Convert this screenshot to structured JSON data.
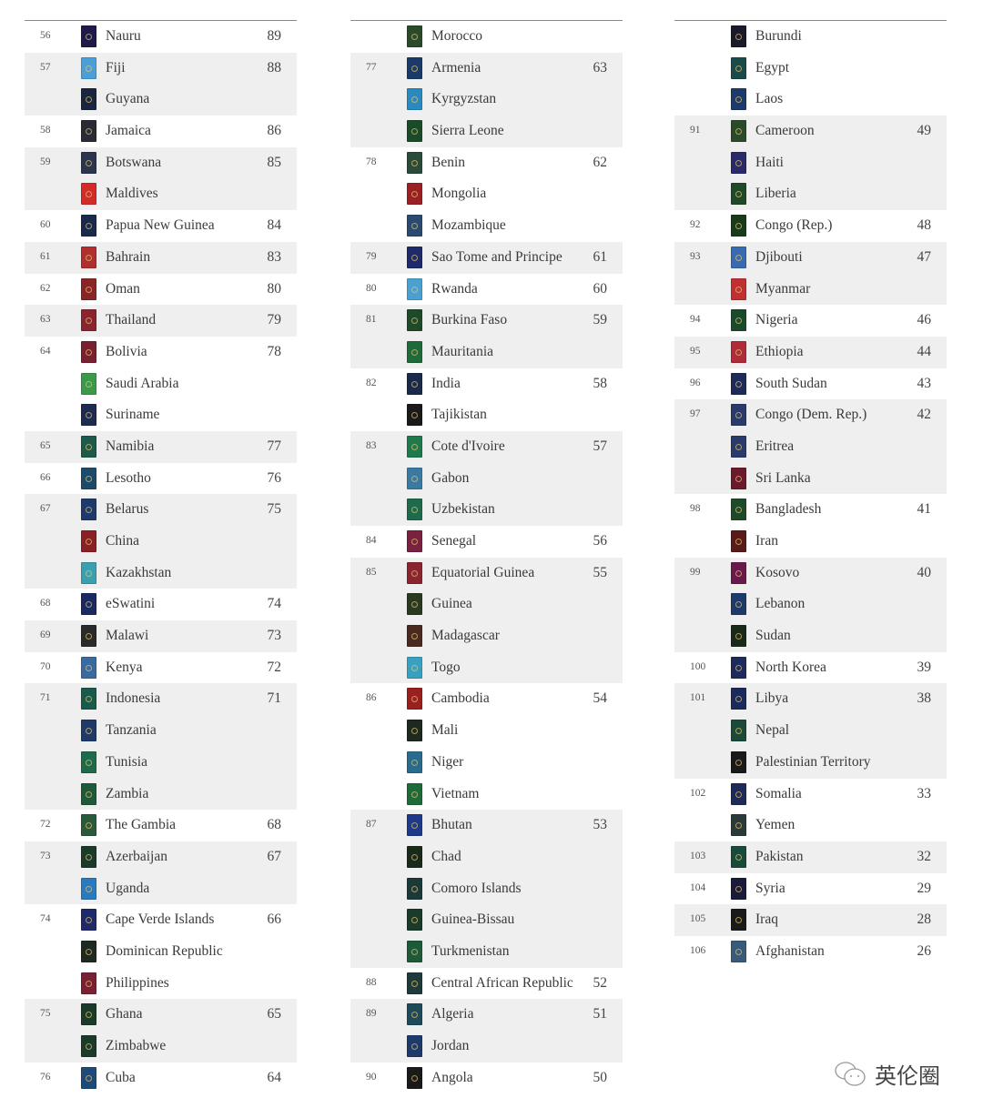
{
  "columns": [
    [
      {
        "rank": "56",
        "score": "89",
        "countries": [
          {
            "name": "Nauru",
            "color": "#1e1a4a"
          }
        ]
      },
      {
        "rank": "57",
        "score": "88",
        "countries": [
          {
            "name": "Fiji",
            "color": "#4a9fd8"
          },
          {
            "name": "Guyana",
            "color": "#1a2540"
          }
        ]
      },
      {
        "rank": "58",
        "score": "86",
        "countries": [
          {
            "name": "Jamaica",
            "color": "#2a2a35"
          }
        ]
      },
      {
        "rank": "59",
        "score": "85",
        "countries": [
          {
            "name": "Botswana",
            "color": "#2b3550"
          },
          {
            "name": "Maldives",
            "color": "#d42a2a"
          }
        ]
      },
      {
        "rank": "60",
        "score": "84",
        "countries": [
          {
            "name": "Papua New Guinea",
            "color": "#1a2a4a"
          }
        ]
      },
      {
        "rank": "61",
        "score": "83",
        "countries": [
          {
            "name": "Bahrain",
            "color": "#b03030"
          }
        ]
      },
      {
        "rank": "62",
        "score": "80",
        "countries": [
          {
            "name": "Oman",
            "color": "#8a2525"
          }
        ]
      },
      {
        "rank": "63",
        "score": "79",
        "countries": [
          {
            "name": "Thailand",
            "color": "#8a2530"
          }
        ]
      },
      {
        "rank": "64",
        "score": "78",
        "countries": [
          {
            "name": "Bolivia",
            "color": "#7a2030"
          },
          {
            "name": "Saudi Arabia",
            "color": "#3a9a4a"
          },
          {
            "name": "Suriname",
            "color": "#1f2a50"
          }
        ]
      },
      {
        "rank": "65",
        "score": "77",
        "countries": [
          {
            "name": "Namibia",
            "color": "#1d5a4a"
          }
        ]
      },
      {
        "rank": "66",
        "score": "76",
        "countries": [
          {
            "name": "Lesotho",
            "color": "#1e4a6a"
          }
        ]
      },
      {
        "rank": "67",
        "score": "75",
        "countries": [
          {
            "name": "Belarus",
            "color": "#1e3a6a"
          },
          {
            "name": "China",
            "color": "#8a2025"
          },
          {
            "name": "Kazakhstan",
            "color": "#3aa0b0"
          }
        ]
      },
      {
        "rank": "68",
        "score": "74",
        "countries": [
          {
            "name": "eSwatini",
            "color": "#1a2a60"
          }
        ]
      },
      {
        "rank": "69",
        "score": "73",
        "countries": [
          {
            "name": "Malawi",
            "color": "#2a2a2a"
          }
        ]
      },
      {
        "rank": "70",
        "score": "72",
        "countries": [
          {
            "name": "Kenya",
            "color": "#3a6aa0"
          }
        ]
      },
      {
        "rank": "71",
        "score": "71",
        "countries": [
          {
            "name": "Indonesia",
            "color": "#1a5a4a"
          },
          {
            "name": "Tanzania",
            "color": "#1e3a6a"
          },
          {
            "name": "Tunisia",
            "color": "#1e6a4a"
          },
          {
            "name": "Zambia",
            "color": "#1e5a3a"
          }
        ]
      },
      {
        "rank": "72",
        "score": "68",
        "countries": [
          {
            "name": "The Gambia",
            "color": "#2a5a3a"
          }
        ]
      },
      {
        "rank": "73",
        "score": "67",
        "countries": [
          {
            "name": "Azerbaijan",
            "color": "#1a3a2a"
          },
          {
            "name": "Uganda",
            "color": "#2a7ac0"
          }
        ]
      },
      {
        "rank": "74",
        "score": "66",
        "countries": [
          {
            "name": "Cape Verde Islands",
            "color": "#1e2a6a"
          },
          {
            "name": "Dominican Republic",
            "color": "#1e2a20"
          },
          {
            "name": "Philippines",
            "color": "#7a2035"
          }
        ]
      },
      {
        "rank": "75",
        "score": "65",
        "countries": [
          {
            "name": "Ghana",
            "color": "#1a3a2a"
          },
          {
            "name": "Zimbabwe",
            "color": "#1a3a2a"
          }
        ]
      },
      {
        "rank": "76",
        "score": "64",
        "countries": [
          {
            "name": "Cuba",
            "color": "#1e4a7a"
          }
        ]
      }
    ],
    [
      {
        "rank": "",
        "score": "",
        "countries": [
          {
            "name": "Morocco",
            "color": "#2a4a2a"
          }
        ]
      },
      {
        "rank": "77",
        "score": "63",
        "countries": [
          {
            "name": "Armenia",
            "color": "#1a3a6a"
          },
          {
            "name": "Kyrgyzstan",
            "color": "#2a8ac0"
          },
          {
            "name": "Sierra Leone",
            "color": "#1a4a2a"
          }
        ]
      },
      {
        "rank": "78",
        "score": "62",
        "countries": [
          {
            "name": "Benin",
            "color": "#2a4a3a"
          },
          {
            "name": "Mongolia",
            "color": "#9a2025"
          },
          {
            "name": "Mozambique",
            "color": "#2a4a70"
          }
        ]
      },
      {
        "rank": "79",
        "score": "61",
        "countries": [
          {
            "name": "Sao Tome and Principe",
            "color": "#1e2a6a"
          }
        ]
      },
      {
        "rank": "80",
        "score": "60",
        "countries": [
          {
            "name": "Rwanda",
            "color": "#4aa0d0"
          }
        ]
      },
      {
        "rank": "81",
        "score": "59",
        "countries": [
          {
            "name": "Burkina Faso",
            "color": "#1e4a2a"
          },
          {
            "name": "Mauritania",
            "color": "#1e6a3a"
          }
        ]
      },
      {
        "rank": "82",
        "score": "58",
        "countries": [
          {
            "name": "India",
            "color": "#1a2a4a"
          },
          {
            "name": "Tajikistan",
            "color": "#1a1a1a"
          }
        ]
      },
      {
        "rank": "83",
        "score": "57",
        "countries": [
          {
            "name": "Cote d'Ivoire",
            "color": "#1e7a4a"
          },
          {
            "name": "Gabon",
            "color": "#3a7aa0"
          },
          {
            "name": "Uzbekistan",
            "color": "#1e6a4a"
          }
        ]
      },
      {
        "rank": "84",
        "score": "56",
        "countries": [
          {
            "name": "Senegal",
            "color": "#7a2040"
          }
        ]
      },
      {
        "rank": "85",
        "score": "55",
        "countries": [
          {
            "name": "Equatorial Guinea",
            "color": "#8a2530"
          },
          {
            "name": "Guinea",
            "color": "#2a3a20"
          },
          {
            "name": "Madagascar",
            "color": "#4a2a20"
          },
          {
            "name": "Togo",
            "color": "#3aa0c0"
          }
        ]
      },
      {
        "rank": "86",
        "score": "54",
        "countries": [
          {
            "name": "Cambodia",
            "color": "#9a2020"
          },
          {
            "name": "Mali",
            "color": "#1e2a20"
          },
          {
            "name": "Niger",
            "color": "#2a6a8a"
          },
          {
            "name": "Vietnam",
            "color": "#1e6a3a"
          }
        ]
      },
      {
        "rank": "87",
        "score": "53",
        "countries": [
          {
            "name": "Bhutan",
            "color": "#1e3a8a"
          },
          {
            "name": "Chad",
            "color": "#1a2a1a"
          },
          {
            "name": "Comoro Islands",
            "color": "#1a3a3a"
          },
          {
            "name": "Guinea-Bissau",
            "color": "#1a3a2a"
          },
          {
            "name": "Turkmenistan",
            "color": "#1e5a3a"
          }
        ]
      },
      {
        "rank": "88",
        "score": "52",
        "countries": [
          {
            "name": "Central African Republic",
            "color": "#1e3a3a"
          }
        ]
      },
      {
        "rank": "89",
        "score": "51",
        "countries": [
          {
            "name": "Algeria",
            "color": "#1e4a5a"
          },
          {
            "name": "Jordan",
            "color": "#1e3a6a"
          }
        ]
      },
      {
        "rank": "90",
        "score": "50",
        "countries": [
          {
            "name": "Angola",
            "color": "#1a1a1a"
          }
        ]
      }
    ],
    [
      {
        "rank": "",
        "score": "",
        "countries": [
          {
            "name": "Burundi",
            "color": "#1a1a2a"
          },
          {
            "name": "Egypt",
            "color": "#1a4a4a"
          },
          {
            "name": "Laos",
            "color": "#1e3a6a"
          }
        ]
      },
      {
        "rank": "91",
        "score": "49",
        "countries": [
          {
            "name": "Cameroon",
            "color": "#2a4a2a"
          },
          {
            "name": "Haiti",
            "color": "#2a2a6a"
          },
          {
            "name": "Liberia",
            "color": "#1e4a2a"
          }
        ]
      },
      {
        "rank": "92",
        "score": "48",
        "countries": [
          {
            "name": "Congo (Rep.)",
            "color": "#1a3a1a"
          }
        ]
      },
      {
        "rank": "93",
        "score": "47",
        "countries": [
          {
            "name": "Djibouti",
            "color": "#3a6ab0"
          },
          {
            "name": "Myanmar",
            "color": "#c03030"
          }
        ]
      },
      {
        "rank": "94",
        "score": "46",
        "countries": [
          {
            "name": "Nigeria",
            "color": "#1a4a2a"
          }
        ]
      },
      {
        "rank": "95",
        "score": "44",
        "countries": [
          {
            "name": "Ethiopia",
            "color": "#b02a3a"
          }
        ]
      },
      {
        "rank": "96",
        "score": "43",
        "countries": [
          {
            "name": "South Sudan",
            "color": "#1e2a5a"
          }
        ]
      },
      {
        "rank": "97",
        "score": "42",
        "countries": [
          {
            "name": "Congo (Dem. Rep.)",
            "color": "#2a3a6a"
          },
          {
            "name": "Eritrea",
            "color": "#2a3a6a"
          },
          {
            "name": "Sri Lanka",
            "color": "#6a1a2a"
          }
        ]
      },
      {
        "rank": "98",
        "score": "41",
        "countries": [
          {
            "name": "Bangladesh",
            "color": "#1e4a2a"
          },
          {
            "name": "Iran",
            "color": "#5a1a1a"
          }
        ]
      },
      {
        "rank": "99",
        "score": "40",
        "countries": [
          {
            "name": "Kosovo",
            "color": "#6a1a4a"
          },
          {
            "name": "Lebanon",
            "color": "#1e3a6a"
          },
          {
            "name": "Sudan",
            "color": "#1a2a1a"
          }
        ]
      },
      {
        "rank": "100",
        "score": "39",
        "countries": [
          {
            "name": "North Korea",
            "color": "#1e2a5a"
          }
        ]
      },
      {
        "rank": "101",
        "score": "38",
        "countries": [
          {
            "name": "Libya",
            "color": "#1a2a5a"
          },
          {
            "name": "Nepal",
            "color": "#1a4a3a"
          },
          {
            "name": "Palestinian Territory",
            "color": "#1a1a1a"
          }
        ]
      },
      {
        "rank": "102",
        "score": "33",
        "countries": [
          {
            "name": "Somalia",
            "color": "#1e2a5a"
          },
          {
            "name": "Yemen",
            "color": "#2a3a3a"
          }
        ]
      },
      {
        "rank": "103",
        "score": "32",
        "countries": [
          {
            "name": "Pakistan",
            "color": "#1a4a3a"
          }
        ]
      },
      {
        "rank": "104",
        "score": "29",
        "countries": [
          {
            "name": "Syria",
            "color": "#1a1a3a"
          }
        ]
      },
      {
        "rank": "105",
        "score": "28",
        "countries": [
          {
            "name": "Iraq",
            "color": "#1a1a1a"
          }
        ]
      },
      {
        "rank": "106",
        "score": "26",
        "countries": [
          {
            "name": "Afghanistan",
            "color": "#3a5a7a"
          }
        ]
      }
    ]
  ],
  "watermark": {
    "text": "英伦圈",
    "icon": "wechat-bubbles-icon"
  }
}
